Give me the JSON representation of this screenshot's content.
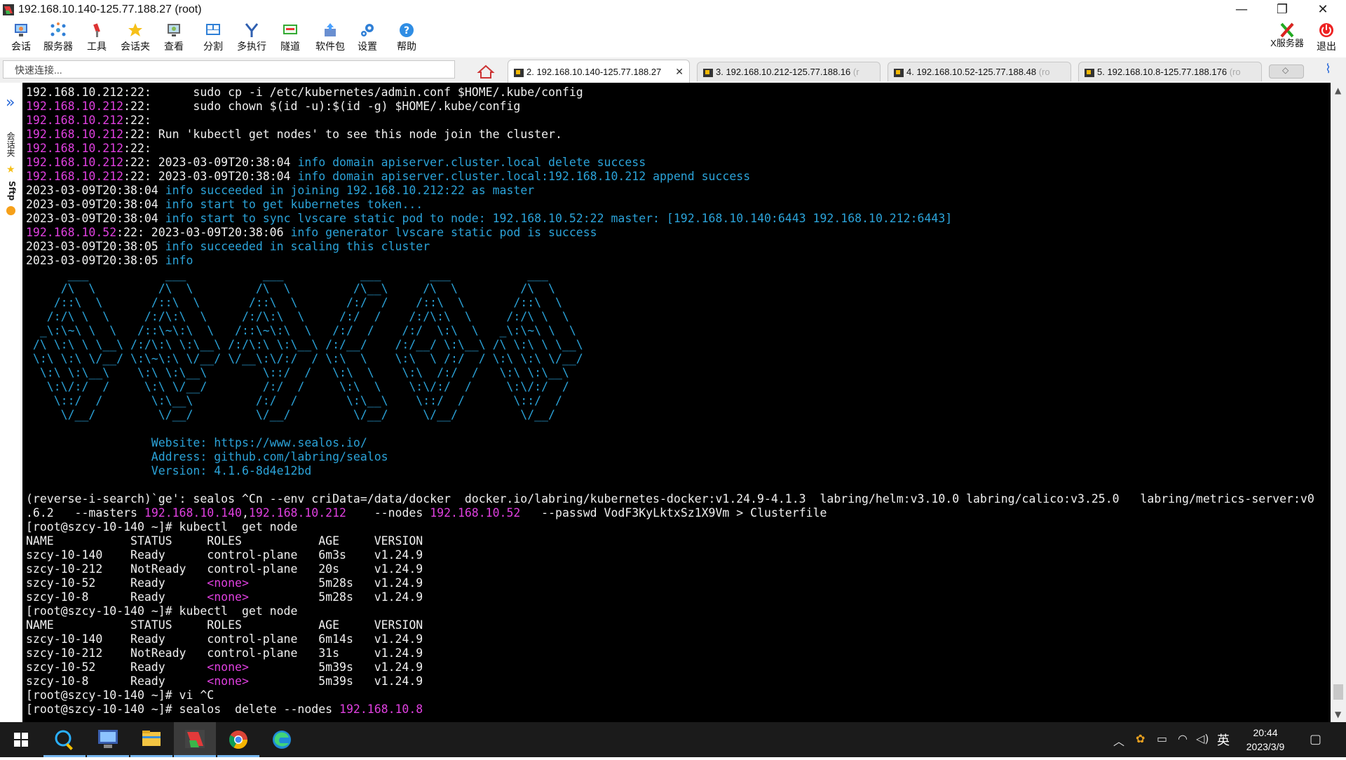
{
  "window": {
    "title": "192.168.10.140-125.77.188.27 (root)",
    "minimize": "—",
    "restore": "❐",
    "close": "✕"
  },
  "toolbar": {
    "items": [
      {
        "label": "会话",
        "icon": "session-icon"
      },
      {
        "label": "服务器",
        "icon": "server-icon"
      },
      {
        "label": "工具",
        "icon": "tools-icon"
      },
      {
        "label": "会话夹",
        "icon": "star-folder-icon"
      },
      {
        "label": "查看",
        "icon": "view-icon"
      },
      {
        "label": "分割",
        "icon": "split-icon"
      },
      {
        "label": "多执行",
        "icon": "multi-exec-icon"
      },
      {
        "label": "隧道",
        "icon": "tunnel-icon"
      },
      {
        "label": "软件包",
        "icon": "package-icon"
      },
      {
        "label": "设置",
        "icon": "settings-icon"
      },
      {
        "label": "帮助",
        "icon": "help-icon"
      }
    ],
    "right": [
      {
        "label": "X服务器",
        "icon": "x-server-icon"
      },
      {
        "label": "退出",
        "icon": "power-icon"
      }
    ]
  },
  "quick_connect": {
    "placeholder": "快速连接..."
  },
  "tabs": [
    {
      "label": "2. 192.168.10.140-125.77.188.27",
      "active": true
    },
    {
      "label": "3. 192.168.10.212-125.77.188.16",
      "suffix": "(r",
      "active": false
    },
    {
      "label": "4. 192.168.10.52-125.77.188.48",
      "suffix": "(ro",
      "active": false
    },
    {
      "label": "5. 192.168.10.8-125.77.188.176",
      "suffix": "(ro",
      "active": false
    }
  ],
  "side_panel": {
    "label1": "会话夹",
    "label2": "Sftp"
  },
  "terminal": {
    "lines": [
      [
        {
          "t": "192.168.10.212:22:      sudo cp -i /etc/kubernetes/admin.conf $HOME/.kube/config"
        }
      ],
      [
        {
          "t": "192.168.10.212",
          "c": "mag"
        },
        {
          "t": ":22:      sudo chown $(id -u):$(id -g) $HOME/.kube/config"
        }
      ],
      [
        {
          "t": "192.168.10.212",
          "c": "mag"
        },
        {
          "t": ":22:"
        }
      ],
      [
        {
          "t": "192.168.10.212",
          "c": "mag"
        },
        {
          "t": ":22: Run 'kubectl get nodes' to see this node join the cluster."
        }
      ],
      [
        {
          "t": "192.168.10.212",
          "c": "mag"
        },
        {
          "t": ":22:"
        }
      ],
      [
        {
          "t": "192.168.10.212",
          "c": "mag"
        },
        {
          "t": ":22: 2023-03-09T20:38:04 "
        },
        {
          "t": "info domain apiserver.cluster.local delete success",
          "c": "cyan"
        }
      ],
      [
        {
          "t": "192.168.10.212",
          "c": "mag"
        },
        {
          "t": ":22: 2023-03-09T20:38:04 "
        },
        {
          "t": "info domain apiserver.cluster.local:192.168.10.212 append success",
          "c": "cyan"
        }
      ],
      [
        {
          "t": "2023-03-09T20:38:04 "
        },
        {
          "t": "info succeeded in joining 192.168.10.212:22 as master",
          "c": "cyan"
        }
      ],
      [
        {
          "t": "2023-03-09T20:38:04 "
        },
        {
          "t": "info start to get kubernetes token...",
          "c": "cyan"
        }
      ],
      [
        {
          "t": "2023-03-09T20:38:04 "
        },
        {
          "t": "info start to sync lvscare static pod to node: 192.168.10.52:22 master: [192.168.10.140:6443 192.168.10.212:6443]",
          "c": "cyan"
        }
      ],
      [
        {
          "t": "192.168.10.52",
          "c": "mag"
        },
        {
          "t": ":22: 2023-03-09T20:38:06 "
        },
        {
          "t": "info generator lvscare static pod is success",
          "c": "cyan"
        }
      ],
      [
        {
          "t": "2023-03-09T20:38:05 "
        },
        {
          "t": "info succeeded in scaling this cluster",
          "c": "cyan"
        }
      ],
      [
        {
          "t": "2023-03-09T20:38:05 "
        },
        {
          "t": "info",
          "c": "cyan"
        }
      ],
      [
        {
          "t": "      ___           ___           ___           ___       ___           ___",
          "c": "cyan"
        }
      ],
      [
        {
          "t": "     /\\  \\         /\\  \\         /\\  \\         /\\__\\     /\\  \\         /\\  \\",
          "c": "cyan"
        }
      ],
      [
        {
          "t": "    /::\\  \\       /::\\  \\       /::\\  \\       /:/  /    /::\\  \\       /::\\  \\",
          "c": "cyan"
        }
      ],
      [
        {
          "t": "   /:/\\ \\  \\     /:/\\:\\  \\     /:/\\:\\  \\     /:/  /    /:/\\:\\  \\     /:/\\ \\  \\",
          "c": "cyan"
        }
      ],
      [
        {
          "t": "  _\\:\\~\\ \\  \\   /::\\~\\:\\  \\   /::\\~\\:\\  \\   /:/  /    /:/  \\:\\  \\   _\\:\\~\\ \\  \\",
          "c": "cyan"
        }
      ],
      [
        {
          "t": " /\\ \\:\\ \\ \\__\\ /:/\\:\\ \\:\\__\\ /:/\\:\\ \\:\\__\\ /:/__/    /:/__/ \\:\\__\\ /\\ \\:\\ \\ \\__\\",
          "c": "cyan"
        }
      ],
      [
        {
          "t": " \\:\\ \\:\\ \\/__/ \\:\\~\\:\\ \\/__/ \\/__\\:\\/:/  / \\:\\  \\    \\:\\  \\ /:/  / \\:\\ \\:\\ \\/__/",
          "c": "cyan"
        }
      ],
      [
        {
          "t": "  \\:\\ \\:\\__\\    \\:\\ \\:\\__\\        \\::/  /   \\:\\  \\    \\:\\  /:/  /   \\:\\ \\:\\__\\",
          "c": "cyan"
        }
      ],
      [
        {
          "t": "   \\:\\/:/  /     \\:\\ \\/__/        /:/  /     \\:\\  \\    \\:\\/:/  /     \\:\\/:/  /",
          "c": "cyan"
        }
      ],
      [
        {
          "t": "    \\::/  /       \\:\\__\\         /:/  /       \\:\\__\\    \\::/  /       \\::/  /",
          "c": "cyan"
        }
      ],
      [
        {
          "t": "     \\/__/         \\/__/         \\/__/         \\/__/     \\/__/         \\/__/",
          "c": "cyan"
        }
      ],
      [
        {
          "t": ""
        }
      ],
      [
        {
          "t": "                  Website: https://www.sealos.io/",
          "c": "cyan"
        }
      ],
      [
        {
          "t": "                  Address: github.com/labring/sealos",
          "c": "cyan"
        }
      ],
      [
        {
          "t": "                  Version: 4.1.6-8d4e12bd",
          "c": "cyan"
        }
      ],
      [
        {
          "t": ""
        }
      ],
      [
        {
          "t": "(reverse-i-search)`ge': sealos ^Cn --env criData=/data/docker  docker.io/labring/kubernetes-docker:v1.24.9-4.1.3  labring/helm:v3.10.0 labring/calico:v3.25.0   labring/metrics-server:v0"
        }
      ],
      [
        {
          "t": ".6.2   --masters "
        },
        {
          "t": "192.168.10.140",
          "c": "mag"
        },
        {
          "t": ","
        },
        {
          "t": "192.168.10.212",
          "c": "mag"
        },
        {
          "t": "    --nodes "
        },
        {
          "t": "192.168.10.52",
          "c": "mag"
        },
        {
          "t": "   --passwd VodF3KyLktxSz1X9Vm > Clusterfile"
        }
      ],
      [
        {
          "t": "[root@szcy-10-140 ~]# kubectl  get node"
        }
      ],
      [
        {
          "t": "NAME           STATUS     ROLES           AGE     VERSION"
        }
      ],
      [
        {
          "t": "szcy-10-140    Ready      control-plane   6m3s    v1.24.9"
        }
      ],
      [
        {
          "t": "szcy-10-212    NotReady   control-plane   20s     v1.24.9"
        }
      ],
      [
        {
          "t": "szcy-10-52     Ready      "
        },
        {
          "t": "<none>",
          "c": "mag"
        },
        {
          "t": "          5m28s   v1.24.9"
        }
      ],
      [
        {
          "t": "szcy-10-8      Ready      "
        },
        {
          "t": "<none>",
          "c": "mag"
        },
        {
          "t": "          5m28s   v1.24.9"
        }
      ],
      [
        {
          "t": "[root@szcy-10-140 ~]# kubectl  get node"
        }
      ],
      [
        {
          "t": "NAME           STATUS     ROLES           AGE     VERSION"
        }
      ],
      [
        {
          "t": "szcy-10-140    Ready      control-plane   6m14s   v1.24.9"
        }
      ],
      [
        {
          "t": "szcy-10-212    NotReady   control-plane   31s     v1.24.9"
        }
      ],
      [
        {
          "t": "szcy-10-52     Ready      "
        },
        {
          "t": "<none>",
          "c": "mag"
        },
        {
          "t": "          5m39s   v1.24.9"
        }
      ],
      [
        {
          "t": "szcy-10-8      Ready      "
        },
        {
          "t": "<none>",
          "c": "mag"
        },
        {
          "t": "          5m39s   v1.24.9"
        }
      ],
      [
        {
          "t": "[root@szcy-10-140 ~]# vi ^C"
        }
      ],
      [
        {
          "t": "[root@szcy-10-140 ~]# sealos  delete --nodes "
        },
        {
          "t": "192.168.10.8",
          "c": "mag"
        }
      ]
    ]
  },
  "taskbar": {
    "apps": [
      "windows-start-icon",
      "search-icon",
      "remote-desktop-icon",
      "file-explorer-icon",
      "mobaxterm-icon",
      "chrome-icon",
      "edge-icon"
    ],
    "ime": "英",
    "time": "20:44",
    "date": "2023/3/9"
  },
  "colors": {
    "info": "#2ba3d9",
    "ip": "#e040e0",
    "terminal_bg": "#000000"
  }
}
